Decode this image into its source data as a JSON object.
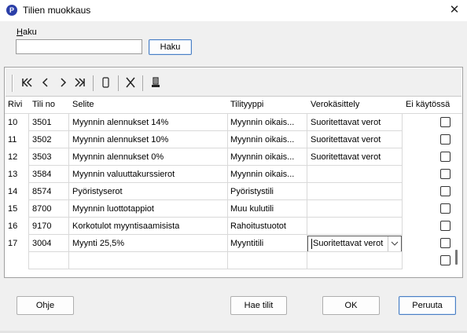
{
  "window": {
    "title": "Tilien muokkaus",
    "app_icon_letter": "P"
  },
  "search": {
    "label": "Haku",
    "value": "",
    "button_label": "Haku"
  },
  "toolbar": {
    "first_icon": "first-record-icon",
    "prev_icon": "previous-record-icon",
    "next_icon": "next-record-icon",
    "last_icon": "last-record-icon",
    "new_icon": "new-record-icon",
    "delete_icon": "delete-record-icon",
    "post_icon": "post-record-icon"
  },
  "table": {
    "columns": [
      "Rivi",
      "Tili no",
      "Selite",
      "Tilityyppi",
      "Verokäsittely",
      "Ei käytössä"
    ],
    "rows": [
      {
        "rivi": "10",
        "tili": "3501",
        "selite": "Myynnin alennukset 14%",
        "tyyppi": "Myynnin oikais...",
        "vero": "Suoritettavat verot",
        "ei": false
      },
      {
        "rivi": "11",
        "tili": "3502",
        "selite": "Myynnin alennukset 10%",
        "tyyppi": "Myynnin oikais...",
        "vero": "Suoritettavat verot",
        "ei": false
      },
      {
        "rivi": "12",
        "tili": "3503",
        "selite": "Myynnin alennukset 0%",
        "tyyppi": "Myynnin oikais...",
        "vero": "Suoritettavat verot",
        "ei": false
      },
      {
        "rivi": "13",
        "tili": "3584",
        "selite": "Myynnin valuuttakurssierot",
        "tyyppi": "Myynnin oikais...",
        "vero": "",
        "ei": false
      },
      {
        "rivi": "14",
        "tili": "8574",
        "selite": "Pyöristyserot",
        "tyyppi": "Pyöristystili",
        "vero": "",
        "ei": false
      },
      {
        "rivi": "15",
        "tili": "8700",
        "selite": "Myynnin luottotappiot",
        "tyyppi": "Muu kulutili",
        "vero": "",
        "ei": false
      },
      {
        "rivi": "16",
        "tili": "9170",
        "selite": "Korkotulot myyntisaamisista",
        "tyyppi": "Rahoitustuotot",
        "vero": "",
        "ei": false
      },
      {
        "rivi": "17",
        "tili": "3004",
        "selite": "Myynti 25,5%",
        "tyyppi": "Myyntitili",
        "vero": "Suoritettavat verot",
        "ei": false
      },
      {
        "rivi": "",
        "tili": "",
        "selite": "",
        "tyyppi": "",
        "vero": "",
        "ei": false
      }
    ]
  },
  "buttons": {
    "help": "Ohje",
    "fetch": "Hae tilit",
    "ok": "OK",
    "cancel": "Peruuta"
  }
}
